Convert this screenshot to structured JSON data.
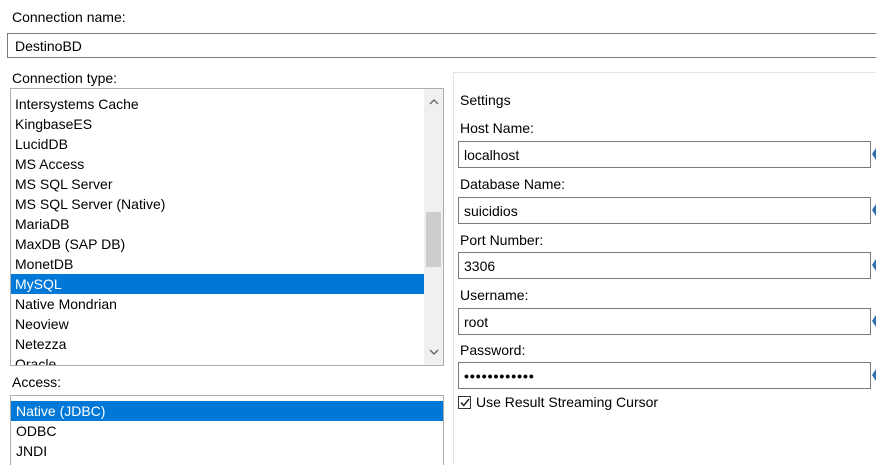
{
  "connection_name": {
    "label": "Connection name:",
    "value": "DestinoBD"
  },
  "connection_type": {
    "label": "Connection type:",
    "items": [
      "Intersystems Cache",
      "KingbaseES",
      "LucidDB",
      "MS Access",
      "MS SQL Server",
      "MS SQL Server (Native)",
      "MariaDB",
      "MaxDB (SAP DB)",
      "MonetDB",
      "MySQL",
      "Native Mondrian",
      "Neoview",
      "Netezza",
      "Oracle"
    ],
    "selected": "MySQL"
  },
  "access": {
    "label": "Access:",
    "items": [
      "Native (JDBC)",
      "ODBC",
      "JNDI"
    ],
    "selected": "Native (JDBC)"
  },
  "settings": {
    "title": "Settings",
    "host_name": {
      "label": "Host Name:",
      "value": "localhost"
    },
    "database_name": {
      "label": "Database Name:",
      "value": "suicidios"
    },
    "port_number": {
      "label": "Port Number:",
      "value": "3306"
    },
    "username": {
      "label": "Username:",
      "value": "root"
    },
    "password": {
      "label": "Password:",
      "masked_value": "••••••••••••"
    },
    "streaming_cursor": {
      "label": "Use Result Streaming Cursor",
      "checked": true
    }
  },
  "colors": {
    "selection": "#0078d7",
    "field_border": "#7a7a7a",
    "scrollbar_track": "#f0f0f0",
    "scrollbar_thumb": "#cdcdcd"
  },
  "icons": {
    "variable_marker": "diamond-icon",
    "scroll_up": "chevron-up-icon",
    "scroll_down": "chevron-down-icon",
    "checkbox": "checkmark-icon"
  }
}
